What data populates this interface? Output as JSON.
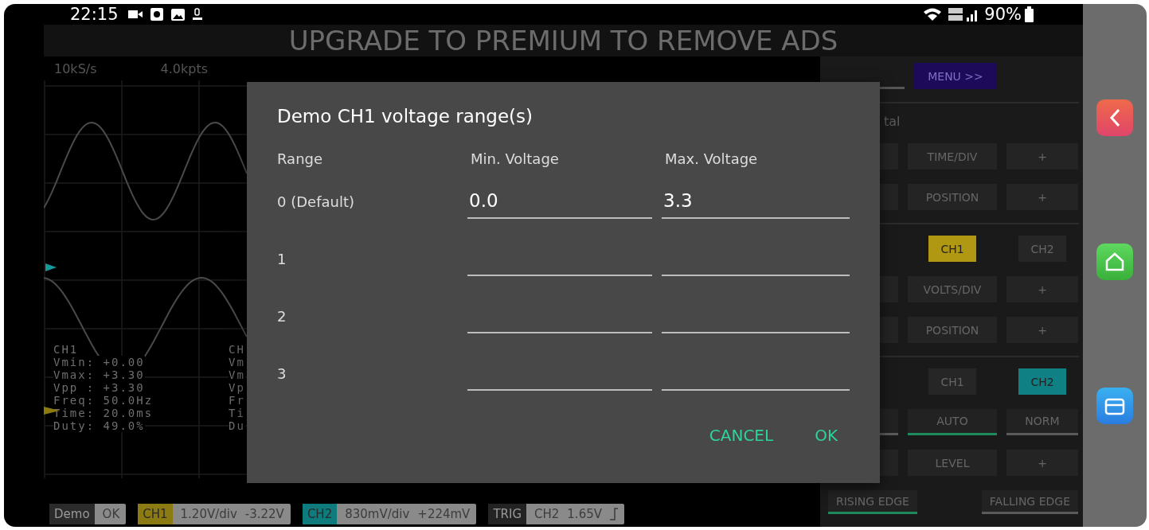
{
  "status_bar": {
    "time": "22:15",
    "battery": "90%"
  },
  "ad_banner": {
    "text": "UPGRADE TO PREMIUM TO REMOVE ADS"
  },
  "scope": {
    "sample_rate": "10kS/s",
    "points": "4.0kpts",
    "measurements": [
      {
        "lines": [
          "CH1",
          "Vmin: +0.00",
          "Vmax: +3.30",
          "Vpp : +3.30",
          "Freq: 50.0Hz",
          "Time: 20.0ms",
          "Duty: 49.0%"
        ]
      },
      {
        "lines": [
          "CH",
          "Vm",
          "Vm",
          "Vp",
          "Fr",
          "Ti",
          "Du"
        ]
      }
    ]
  },
  "bottom_bar": [
    {
      "kind": "status",
      "label": "Demo",
      "color": "#2b2b2b",
      "items": [
        "OK"
      ]
    },
    {
      "kind": "channel",
      "label": "CH1",
      "color": "#8c7b12",
      "items": [
        "1.20V/div",
        "-3.22V"
      ]
    },
    {
      "kind": "channel",
      "label": "CH2",
      "color": "#0e7c7d",
      "items": [
        "830mV/div",
        "+224mV"
      ]
    },
    {
      "kind": "trigger",
      "label": "TRIG",
      "color": "#232323",
      "items": [
        "CH2",
        "1.65V"
      ]
    }
  ],
  "control_panel": {
    "sections": [
      {
        "rows": [
          {
            "cells": [
              {
                "kind": "field"
              },
              {
                "kind": "menu",
                "label": "MENU >>"
              }
            ]
          }
        ]
      },
      {
        "label": "tal",
        "rows": [
          {
            "cells": [
              {
                "kind": "blank"
              },
              {
                "kind": "button",
                "label": "TIME/DIV"
              },
              {
                "kind": "button",
                "label": "+"
              }
            ]
          },
          {
            "cells": [
              {
                "kind": "blank"
              },
              {
                "kind": "button",
                "label": "POSITION"
              },
              {
                "kind": "button",
                "label": "+"
              }
            ]
          }
        ]
      },
      {
        "rows": [
          {
            "cells": [
              {
                "kind": "none"
              },
              {
                "kind": "channel",
                "label": "CH1",
                "selected": true,
                "color": "#b09812"
              },
              {
                "kind": "channel",
                "label": "CH2",
                "selected": false
              }
            ]
          },
          {
            "cells": [
              {
                "kind": "blank"
              },
              {
                "kind": "button",
                "label": "VOLTS/DIV"
              },
              {
                "kind": "button",
                "label": "+"
              }
            ]
          },
          {
            "cells": [
              {
                "kind": "blank"
              },
              {
                "kind": "button",
                "label": "POSITION"
              },
              {
                "kind": "button",
                "label": "+"
              }
            ]
          }
        ]
      },
      {
        "rows": [
          {
            "cells": [
              {
                "kind": "none"
              },
              {
                "kind": "channel",
                "label": "CH1",
                "selected": false
              },
              {
                "kind": "channel",
                "label": "CH2",
                "selected": true,
                "color": "#0f8083"
              }
            ]
          },
          {
            "cells": [
              {
                "kind": "tab",
                "selected": false
              },
              {
                "kind": "tab",
                "label": "AUTO",
                "selected": true
              },
              {
                "kind": "tab",
                "label": "NORM",
                "selected": false
              }
            ]
          },
          {
            "cells": [
              {
                "kind": "blank"
              },
              {
                "kind": "button",
                "label": "LEVEL"
              },
              {
                "kind": "button",
                "label": "+"
              }
            ]
          },
          {
            "kind": "edge",
            "cells": [
              {
                "kind": "tab",
                "label": "RISING EDGE",
                "selected": true
              },
              {
                "kind": "none"
              },
              {
                "kind": "tab",
                "label": "FALLING EDGE",
                "selected": false
              }
            ]
          }
        ]
      }
    ]
  },
  "dialog": {
    "title": "Demo CH1 voltage range(s)",
    "columns": [
      "Range",
      "Min. Voltage",
      "Max. Voltage"
    ],
    "rows": [
      {
        "range": "0 (Default)",
        "min": "0.0",
        "max": "3.3"
      },
      {
        "range": "1"
      },
      {
        "range": "2"
      },
      {
        "range": "3"
      }
    ],
    "buttons": [
      "CANCEL",
      "OK"
    ]
  }
}
